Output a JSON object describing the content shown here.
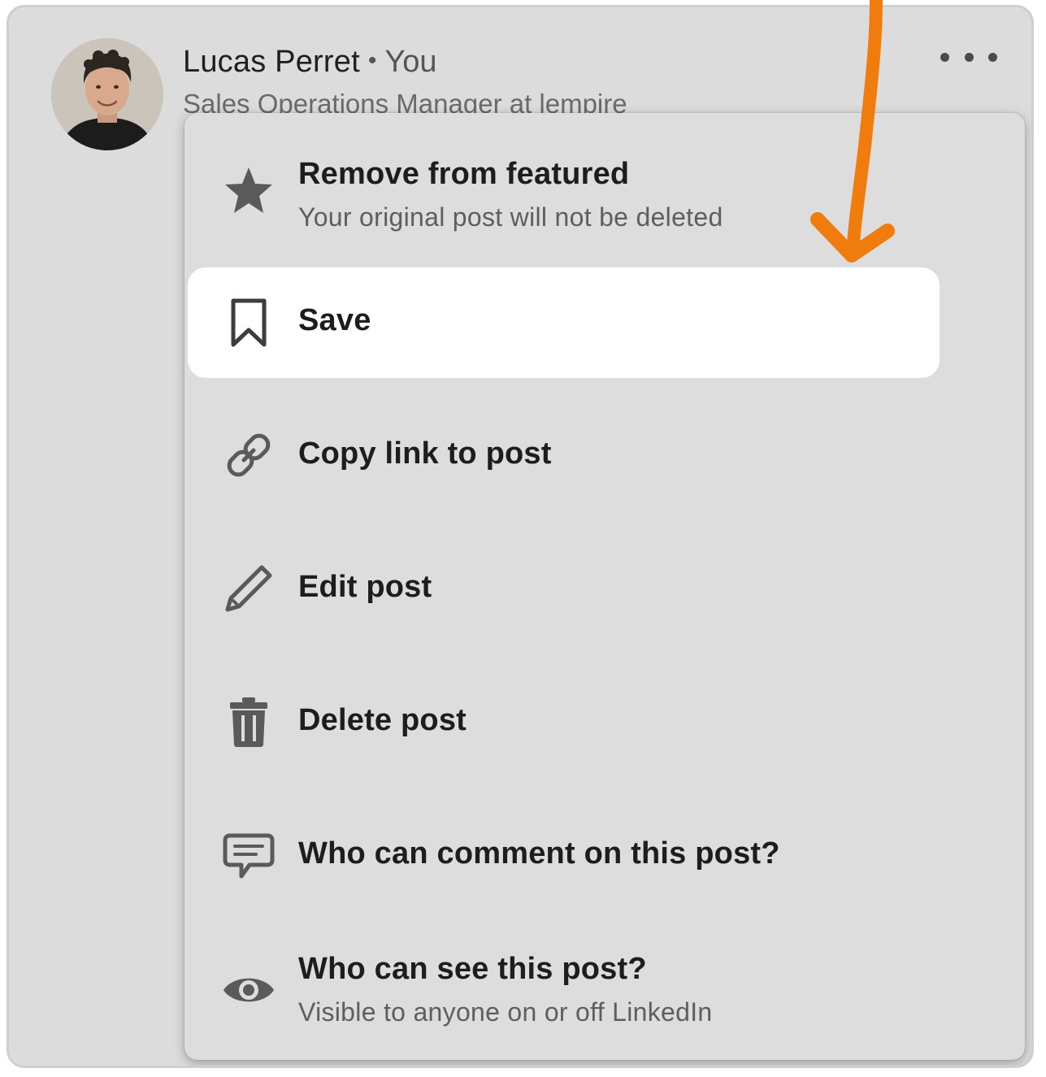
{
  "post": {
    "author_name": "Lucas Perret",
    "separator": "•",
    "author_relation": "You",
    "author_headline": "Sales Operations Manager at lempire",
    "more_icon": "more-horizontal-icon"
  },
  "menu": {
    "items": [
      {
        "icon": "star-icon",
        "label": "Remove from featured",
        "sub": "Your original post will not be deleted"
      },
      {
        "icon": "bookmark-icon",
        "label": "Save",
        "sub": ""
      },
      {
        "icon": "link-icon",
        "label": "Copy link to post",
        "sub": ""
      },
      {
        "icon": "pencil-icon",
        "label": "Edit post",
        "sub": ""
      },
      {
        "icon": "trash-icon",
        "label": "Delete post",
        "sub": ""
      },
      {
        "icon": "comment-icon",
        "label": "Who can comment on this post?",
        "sub": ""
      },
      {
        "icon": "eye-icon",
        "label": "Who can see this post?",
        "sub": "Visible to anyone on or off LinkedIn"
      }
    ],
    "highlighted_item": "Save"
  },
  "colors": {
    "arrow": "#f07c0e",
    "icon": "#5a5a5a",
    "card_background": "#dcdcdc",
    "highlight": "#ffffff"
  }
}
